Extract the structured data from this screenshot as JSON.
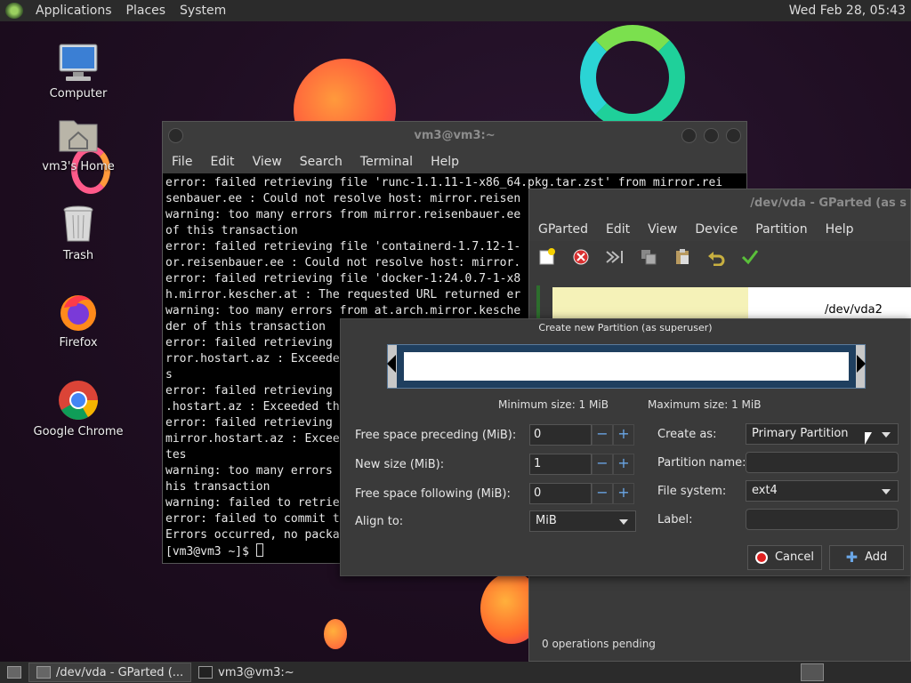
{
  "top_panel": {
    "menus": [
      "Applications",
      "Places",
      "System"
    ],
    "clock": "Wed Feb 28, 05:43"
  },
  "desktop_icons": [
    {
      "label": "Computer",
      "icon": "computer-icon"
    },
    {
      "label": "vm3's Home",
      "icon": "home-folder-icon"
    },
    {
      "label": "Trash",
      "icon": "trash-icon"
    },
    {
      "label": "Firefox",
      "icon": "firefox-icon"
    },
    {
      "label": "Google Chrome",
      "icon": "chrome-icon"
    }
  ],
  "terminal": {
    "title": "vm3@vm3:~",
    "menu": [
      "File",
      "Edit",
      "View",
      "Search",
      "Terminal",
      "Help"
    ],
    "lines": [
      "error: failed retrieving file 'runc-1.1.11-1-x86_64.pkg.tar.zst' from mirror.rei",
      "senbauer.ee : Could not resolve host: mirror.reisen",
      "warning: too many errors from mirror.reisenbauer.ee",
      "of this transaction",
      "error: failed retrieving file 'containerd-1.7.12-1-",
      "or.reisenbauer.ee : Could not resolve host: mirror.",
      "error: failed retrieving file 'docker-1:24.0.7-1-x8",
      "h.mirror.kescher.at : The requested URL returned er",
      "warning: too many errors from at.arch.mirror.kesche",
      "der of this transaction",
      "error: failed retrieving",
      "rror.hostart.az : Exceede",
      "s",
      "error: failed retrieving",
      ".hostart.az : Exceeded th",
      "error: failed retrieving",
      "mirror.hostart.az : Excee",
      "tes",
      "warning: too many errors",
      "his transaction",
      "warning: failed to retrie",
      "error: failed to commit t",
      "Errors occurred, no packa"
    ],
    "prompt": "[vm3@vm3 ~]$ "
  },
  "gparted": {
    "title": "/dev/vda - GParted (as s",
    "menu": [
      "GParted",
      "Edit",
      "View",
      "Device",
      "Partition",
      "Help"
    ],
    "toolbar_icons": [
      "new-partition-icon",
      "delete-icon",
      "resize-icon",
      "copy-icon",
      "paste-icon",
      "undo-icon",
      "apply-icon"
    ],
    "partition_label": "/dev/vda2",
    "status": "0 operations pending"
  },
  "dialog": {
    "title": "Create new Partition (as superuser)",
    "min_size": "Minimum size: 1 MiB",
    "max_size": "Maximum size: 1 MiB",
    "free_preceding_label": "Free space preceding (MiB):",
    "free_preceding_value": "0",
    "new_size_label": "New size (MiB):",
    "new_size_value": "1",
    "free_following_label": "Free space following (MiB):",
    "free_following_value": "0",
    "align_label": "Align to:",
    "align_value": "MiB",
    "create_as_label": "Create as:",
    "create_as_value": "Primary Partition",
    "partition_name_label": "Partition name:",
    "file_system_label": "File system:",
    "file_system_value": "ext4",
    "label_label": "Label:",
    "cancel_label": "Cancel",
    "add_label": "Add"
  },
  "taskbar": {
    "tasks": [
      "/dev/vda - GParted (...",
      "vm3@vm3:~"
    ]
  }
}
